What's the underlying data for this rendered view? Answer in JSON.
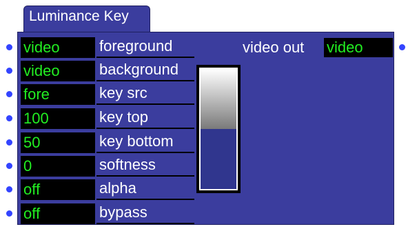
{
  "window": {
    "title": "Luminance Key"
  },
  "inputs": [
    {
      "value": "video",
      "label": "foreground"
    },
    {
      "value": "video",
      "label": "background"
    },
    {
      "value": "fore",
      "label": "key src"
    },
    {
      "value": "100",
      "label": "key top"
    },
    {
      "value": "50",
      "label": "key bottom"
    },
    {
      "value": "0",
      "label": "softness"
    },
    {
      "value": "off",
      "label": "alpha"
    },
    {
      "value": "off",
      "label": "bypass"
    }
  ],
  "output": {
    "label": "video out",
    "value": "video"
  },
  "preview_slider": {
    "level": 0.5
  },
  "colors": {
    "panel": "#3b3d9e",
    "value_text": "#22ee22",
    "port": "#3344ff"
  }
}
